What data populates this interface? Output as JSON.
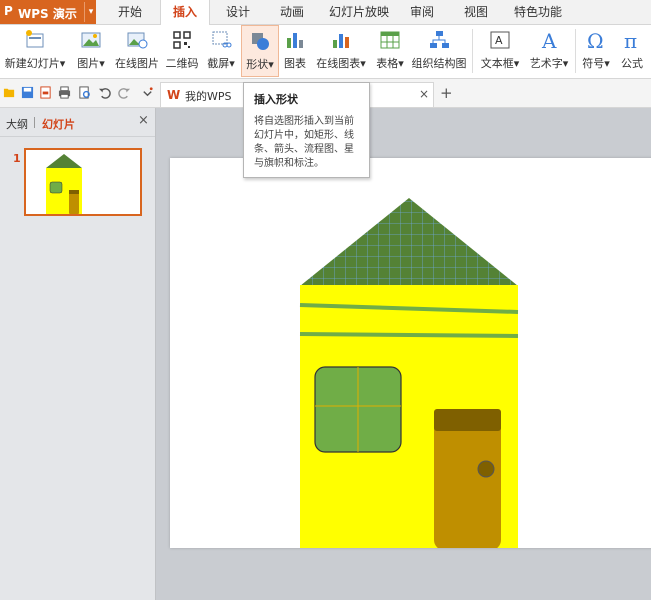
{
  "app": {
    "logo_glyph": "P",
    "name": "WPS 演示",
    "menu_arrow": "▾"
  },
  "menu_tabs": [
    "开始",
    "插入",
    "设计",
    "动画",
    "幻灯片放映",
    "审阅",
    "视图",
    "特色功能"
  ],
  "active_tab": "插入",
  "ribbon": {
    "new_slide": "新建幻灯片",
    "picture": "图片",
    "online_picture": "在线图片",
    "qrcode": "二维码",
    "screenshot": "截屏",
    "shape": "形状",
    "chart": "图表",
    "online_chart": "在线图表",
    "table": "表格",
    "org_chart": "组织结构图",
    "textbox": "文本框",
    "wordart": "艺术字",
    "symbol": "符号",
    "formula": "公式",
    "dropdown_glyph": "▾"
  },
  "doc_tab": {
    "name": "我的WPS",
    "close_glyph": "×"
  },
  "add_tab_glyph": "+",
  "left_panel": {
    "tab_outline": "大纲",
    "tab_slides": "幻灯片",
    "close_glyph": "×",
    "slide_number": "1"
  },
  "tooltip": {
    "title": "插入形状",
    "body": "将自选图形插入到当前幻灯片中，如矩形、线条、箭头、流程图、星与旗帜和标注。"
  },
  "colors": {
    "accent": "#d8651f",
    "house_wall": "#ffff00",
    "roof": "#548235",
    "window": "#70ad47",
    "door": "#bf8f00",
    "door_top": "#7f6000",
    "stripe": "#70ad47"
  }
}
